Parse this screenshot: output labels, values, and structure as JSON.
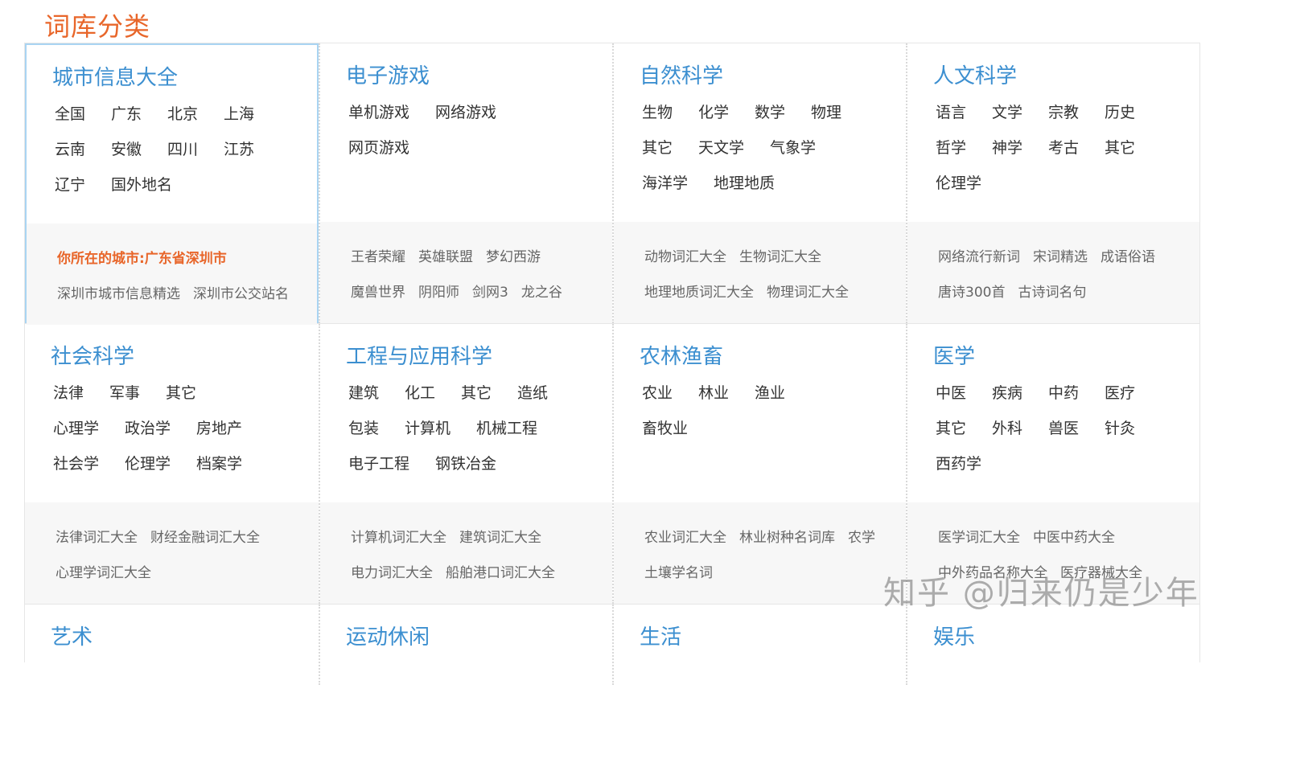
{
  "page_title": "词库分类",
  "watermark": "知乎 @归来仍是少年",
  "rows": [
    [
      {
        "title": "城市信息大全",
        "links": [
          [
            "全国",
            "广东",
            "北京",
            "上海"
          ],
          [
            "云南",
            "安徽",
            "四川",
            "江苏"
          ],
          [
            "辽宁",
            "国外地名"
          ]
        ],
        "sub_city": "你所在的城市:广东省深圳市",
        "sub": [
          [
            "深圳市城市信息精选",
            "深圳市公交站名"
          ]
        ]
      },
      {
        "title": "电子游戏",
        "links": [
          [
            "单机游戏",
            "网络游戏"
          ],
          [
            "网页游戏"
          ]
        ],
        "sub": [
          [
            "王者荣耀",
            "英雄联盟",
            "梦幻西游"
          ],
          [
            "魔兽世界",
            "阴阳师",
            "剑网3",
            "龙之谷"
          ]
        ]
      },
      {
        "title": "自然科学",
        "links": [
          [
            "生物",
            "化学",
            "数学",
            "物理"
          ],
          [
            "其它",
            "天文学",
            "气象学"
          ],
          [
            "海洋学",
            "地理地质"
          ]
        ],
        "sub": [
          [
            "动物词汇大全",
            "生物词汇大全"
          ],
          [
            "地理地质词汇大全",
            "物理词汇大全"
          ]
        ]
      },
      {
        "title": "人文科学",
        "links": [
          [
            "语言",
            "文学",
            "宗教",
            "历史"
          ],
          [
            "哲学",
            "神学",
            "考古",
            "其它"
          ],
          [
            "伦理学"
          ]
        ],
        "sub": [
          [
            "网络流行新词",
            "宋词精选",
            "成语俗语"
          ],
          [
            "唐诗300首",
            "古诗词名句"
          ]
        ]
      }
    ],
    [
      {
        "title": "社会科学",
        "links": [
          [
            "法律",
            "军事",
            "其它"
          ],
          [
            "心理学",
            "政治学",
            "房地产"
          ],
          [
            "社会学",
            "伦理学",
            "档案学"
          ]
        ],
        "sub": [
          [
            "法律词汇大全",
            "财经金融词汇大全"
          ],
          [
            "心理学词汇大全"
          ]
        ]
      },
      {
        "title": "工程与应用科学",
        "links": [
          [
            "建筑",
            "化工",
            "其它",
            "造纸"
          ],
          [
            "包装",
            "计算机",
            "机械工程"
          ],
          [
            "电子工程",
            "钢铁冶金"
          ]
        ],
        "sub": [
          [
            "计算机词汇大全",
            "建筑词汇大全"
          ],
          [
            "电力词汇大全",
            "船舶港口词汇大全"
          ]
        ]
      },
      {
        "title": "农林渔畜",
        "links": [
          [
            "农业",
            "林业",
            "渔业"
          ],
          [
            "畜牧业"
          ]
        ],
        "sub": [
          [
            "农业词汇大全",
            "林业树种名词库",
            "农学"
          ],
          [
            "土壤学名词"
          ]
        ]
      },
      {
        "title": "医学",
        "links": [
          [
            "中医",
            "疾病",
            "中药",
            "医疗"
          ],
          [
            "其它",
            "外科",
            "兽医",
            "针灸"
          ],
          [
            "西药学"
          ]
        ],
        "sub": [
          [
            "医学词汇大全",
            "中医中药大全"
          ],
          [
            "中外药品名称大全",
            "医疗器械大全"
          ]
        ]
      }
    ],
    [
      {
        "title": "艺术",
        "links": [],
        "sub": []
      },
      {
        "title": "运动休闲",
        "links": [],
        "sub": []
      },
      {
        "title": "生活",
        "links": [],
        "sub": []
      },
      {
        "title": "娱乐",
        "links": [],
        "sub": []
      }
    ]
  ]
}
